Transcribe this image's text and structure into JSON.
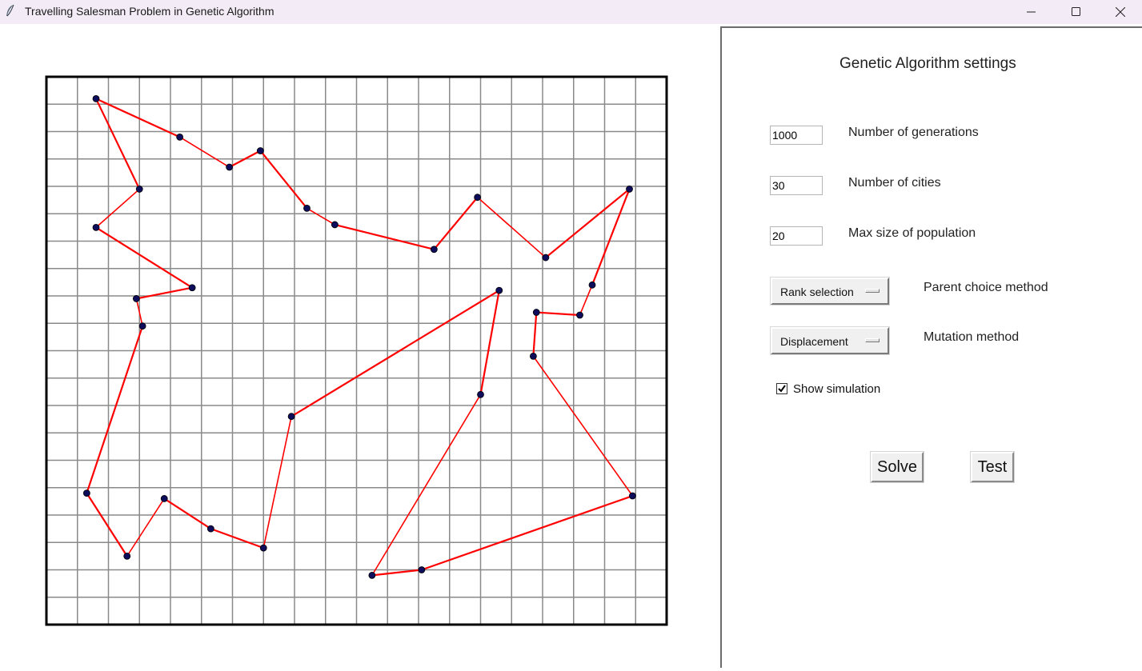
{
  "window": {
    "title": "Travelling Salesman Problem in Genetic Algorithm"
  },
  "settings": {
    "title": "Genetic Algorithm settings",
    "generations": {
      "value": "1000",
      "label": "Number of generations"
    },
    "cities": {
      "value": "30",
      "label": "Number of cities"
    },
    "population": {
      "value": "20",
      "label": "Max size of population"
    },
    "parent_choice": {
      "selected": "Rank selection",
      "label": "Parent choice method"
    },
    "mutation": {
      "selected": "Displacement",
      "label": "Mutation method"
    },
    "show_simulation": {
      "label": "Show simulation",
      "checked": true
    },
    "solve_label": "Solve",
    "test_label": "Test"
  },
  "colors": {
    "route": "#ff0000",
    "city": "#0d0d5c",
    "grid": "#8a8a8a",
    "border": "#000000"
  },
  "chart_data": {
    "type": "scatter",
    "grid": true,
    "grid_cells": [
      20,
      20
    ],
    "cities": [
      [
        1.6,
        19.2
      ],
      [
        4.3,
        17.8
      ],
      [
        5.9,
        16.7
      ],
      [
        6.9,
        17.3
      ],
      [
        8.4,
        15.2
      ],
      [
        9.3,
        14.6
      ],
      [
        12.5,
        13.7
      ],
      [
        13.9,
        15.6
      ],
      [
        16.1,
        13.4
      ],
      [
        18.8,
        15.9
      ],
      [
        17.6,
        12.4
      ],
      [
        17.2,
        11.3
      ],
      [
        15.8,
        11.4
      ],
      [
        15.7,
        9.8
      ],
      [
        18.9,
        4.7
      ],
      [
        12.1,
        2.0
      ],
      [
        10.5,
        1.8
      ],
      [
        14.0,
        8.4
      ],
      [
        14.6,
        12.2
      ],
      [
        7.9,
        7.6
      ],
      [
        7.0,
        2.8
      ],
      [
        5.3,
        3.5
      ],
      [
        3.8,
        4.6
      ],
      [
        2.6,
        2.5
      ],
      [
        1.3,
        4.8
      ],
      [
        3.1,
        10.9
      ],
      [
        2.9,
        11.9
      ],
      [
        4.7,
        12.3
      ],
      [
        1.6,
        14.5
      ],
      [
        3.0,
        15.9
      ]
    ],
    "route": [
      0,
      1,
      2,
      3,
      4,
      5,
      6,
      7,
      8,
      9,
      10,
      11,
      12,
      13,
      14,
      15,
      16,
      17,
      18,
      19,
      20,
      21,
      22,
      23,
      24,
      25,
      26,
      27,
      28,
      29,
      0
    ]
  }
}
